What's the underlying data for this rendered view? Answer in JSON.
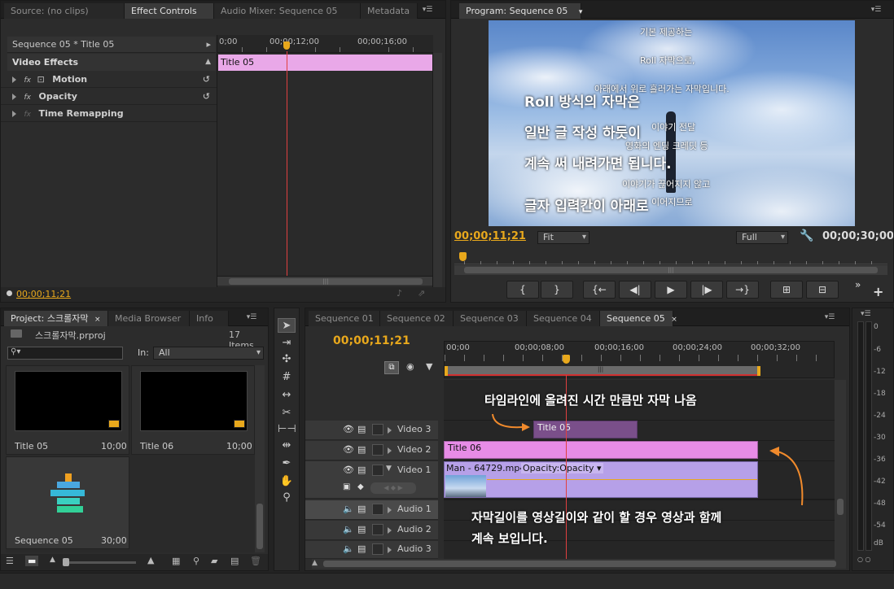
{
  "source_panel": {
    "tabs": [
      "Source: (no clips)",
      "Effect Controls",
      "Audio Mixer: Sequence 05",
      "Metadata"
    ],
    "sequence_label": "Sequence 05 * Title 05",
    "ruler": [
      "0;00",
      "00;00;12;00",
      "00;00;16;00"
    ],
    "clip_label": "Title 05",
    "video_effects": "Video Effects",
    "effects": [
      "Motion",
      "Opacity",
      "Time Remapping"
    ],
    "timecode": "00;00;11;21"
  },
  "program_panel": {
    "tab": "Program: Sequence 05",
    "overlay_small": [
      "기본 제공하는",
      "Roll 자막으로,",
      "아래에서 위로 흘러가는 자막입니다.",
      "이야기 전달",
      "영화의 엔딩 크레딧 등",
      "이야기가 끊어지지 않고",
      "이어지므로"
    ],
    "overlay_large": [
      "Roll 방식의 자막은",
      "일반 글 작성 하듯이",
      "계속 써 내려가면 됩니다.",
      "글자 입력칸이 아래로"
    ],
    "timecode_current": "00;00;11;21",
    "fit_label": "Fit",
    "quality_label": "Full",
    "timecode_total": "00;00;30;00",
    "transport": [
      "{",
      "}",
      "{←",
      "◀|",
      "▶",
      "|▶",
      "→}",
      "⊞",
      "⊟"
    ]
  },
  "project_panel": {
    "tabs": [
      "Project: 스크롤자막",
      "Media Browser",
      "Info"
    ],
    "project_file": "스크롤자막.prproj",
    "item_count": "17 Items",
    "in_label": "In:",
    "in_value": "All",
    "items": [
      {
        "name": "Title 05",
        "duration": "10;00"
      },
      {
        "name": "Title 06",
        "duration": "10;00"
      },
      {
        "name": "Sequence 05",
        "duration": "30;00"
      }
    ]
  },
  "timeline_panel": {
    "tabs": [
      "Sequence 01",
      "Sequence 02",
      "Sequence 03",
      "Sequence 04",
      "Sequence 05"
    ],
    "timecode": "00;00;11;21",
    "ruler": [
      "00;00",
      "00;00;08;00",
      "00;00;16;00",
      "00;00;24;00",
      "00;00;32;00"
    ],
    "tracks": [
      "Video 3",
      "Video 2",
      "Video 1",
      "Audio 1",
      "Audio 2",
      "Audio 3"
    ],
    "clips": {
      "v3": "Title 05",
      "v2": "Title 06",
      "v1": "Man - 64729.mp4",
      "v1_fx": "Opacity:Opacity"
    },
    "annotation_top": "타임라인에 올려진 시간 만큼만 자막 나옴",
    "annotation_bottom_1": "자막길이를 영상길이와 같이 할 경우 영상과 함께",
    "annotation_bottom_2": "계속 보입니다."
  },
  "meter": {
    "labels": [
      "0",
      "-6",
      "-12",
      "-18",
      "-24",
      "-30",
      "-36",
      "-42",
      "-48",
      "-54",
      "dB"
    ]
  },
  "colors": {
    "timecode": "#e8a81c",
    "clip_pink": "#e792e6",
    "clip_purple": "#7a4f8a",
    "clip_video": "#b39ae6",
    "annotation_arrow": "#f08a2c",
    "playhead": "#e04040"
  }
}
